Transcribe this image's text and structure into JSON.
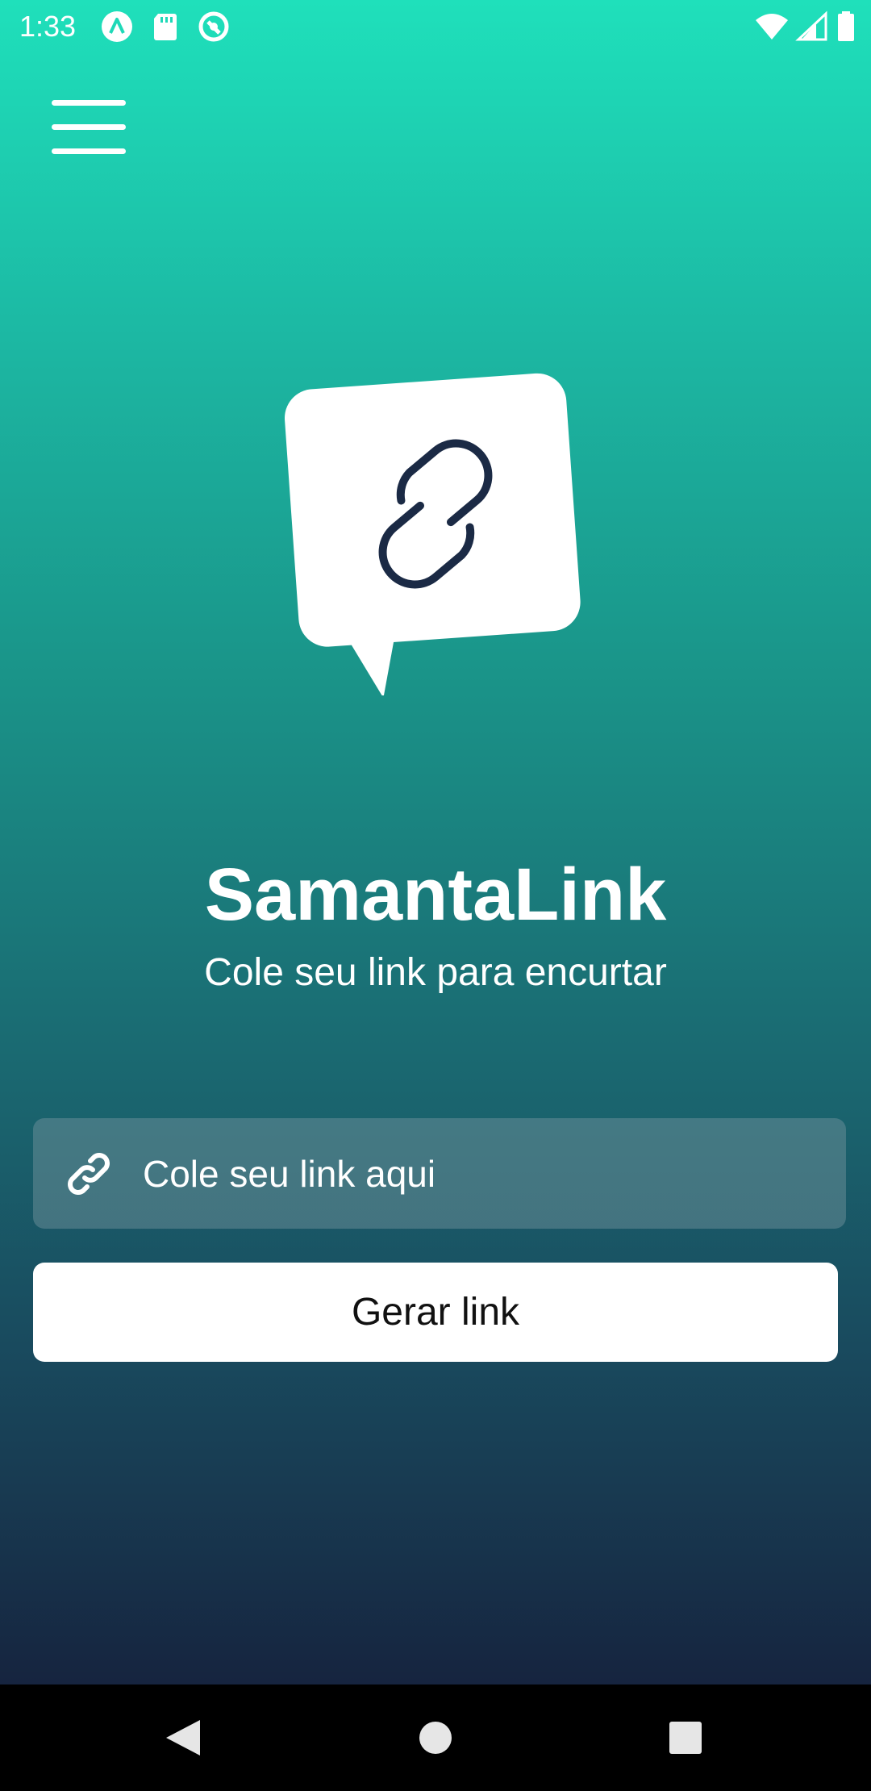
{
  "status_bar": {
    "time": "1:33",
    "left_icons": [
      "app-a-icon",
      "sd-card-icon",
      "sync-icon"
    ],
    "right_icons": [
      "wifi-icon",
      "signal-icon",
      "battery-icon"
    ]
  },
  "header": {
    "menu_icon": "hamburger-menu-icon"
  },
  "hero": {
    "logo_icon": "chat-bubble-link-icon",
    "title": "SamantaLink",
    "subtitle": "Cole seu link para encurtar"
  },
  "form": {
    "input_icon": "link-icon",
    "input_placeholder": "Cole seu link aqui",
    "input_value": "",
    "button_label": "Gerar link"
  },
  "navigation": {
    "buttons": [
      "back",
      "home",
      "recents"
    ]
  },
  "colors": {
    "gradient_top": "#1fe0bb",
    "gradient_bottom": "#16243f",
    "icon_dark": "#1b2a45",
    "white": "#ffffff"
  }
}
